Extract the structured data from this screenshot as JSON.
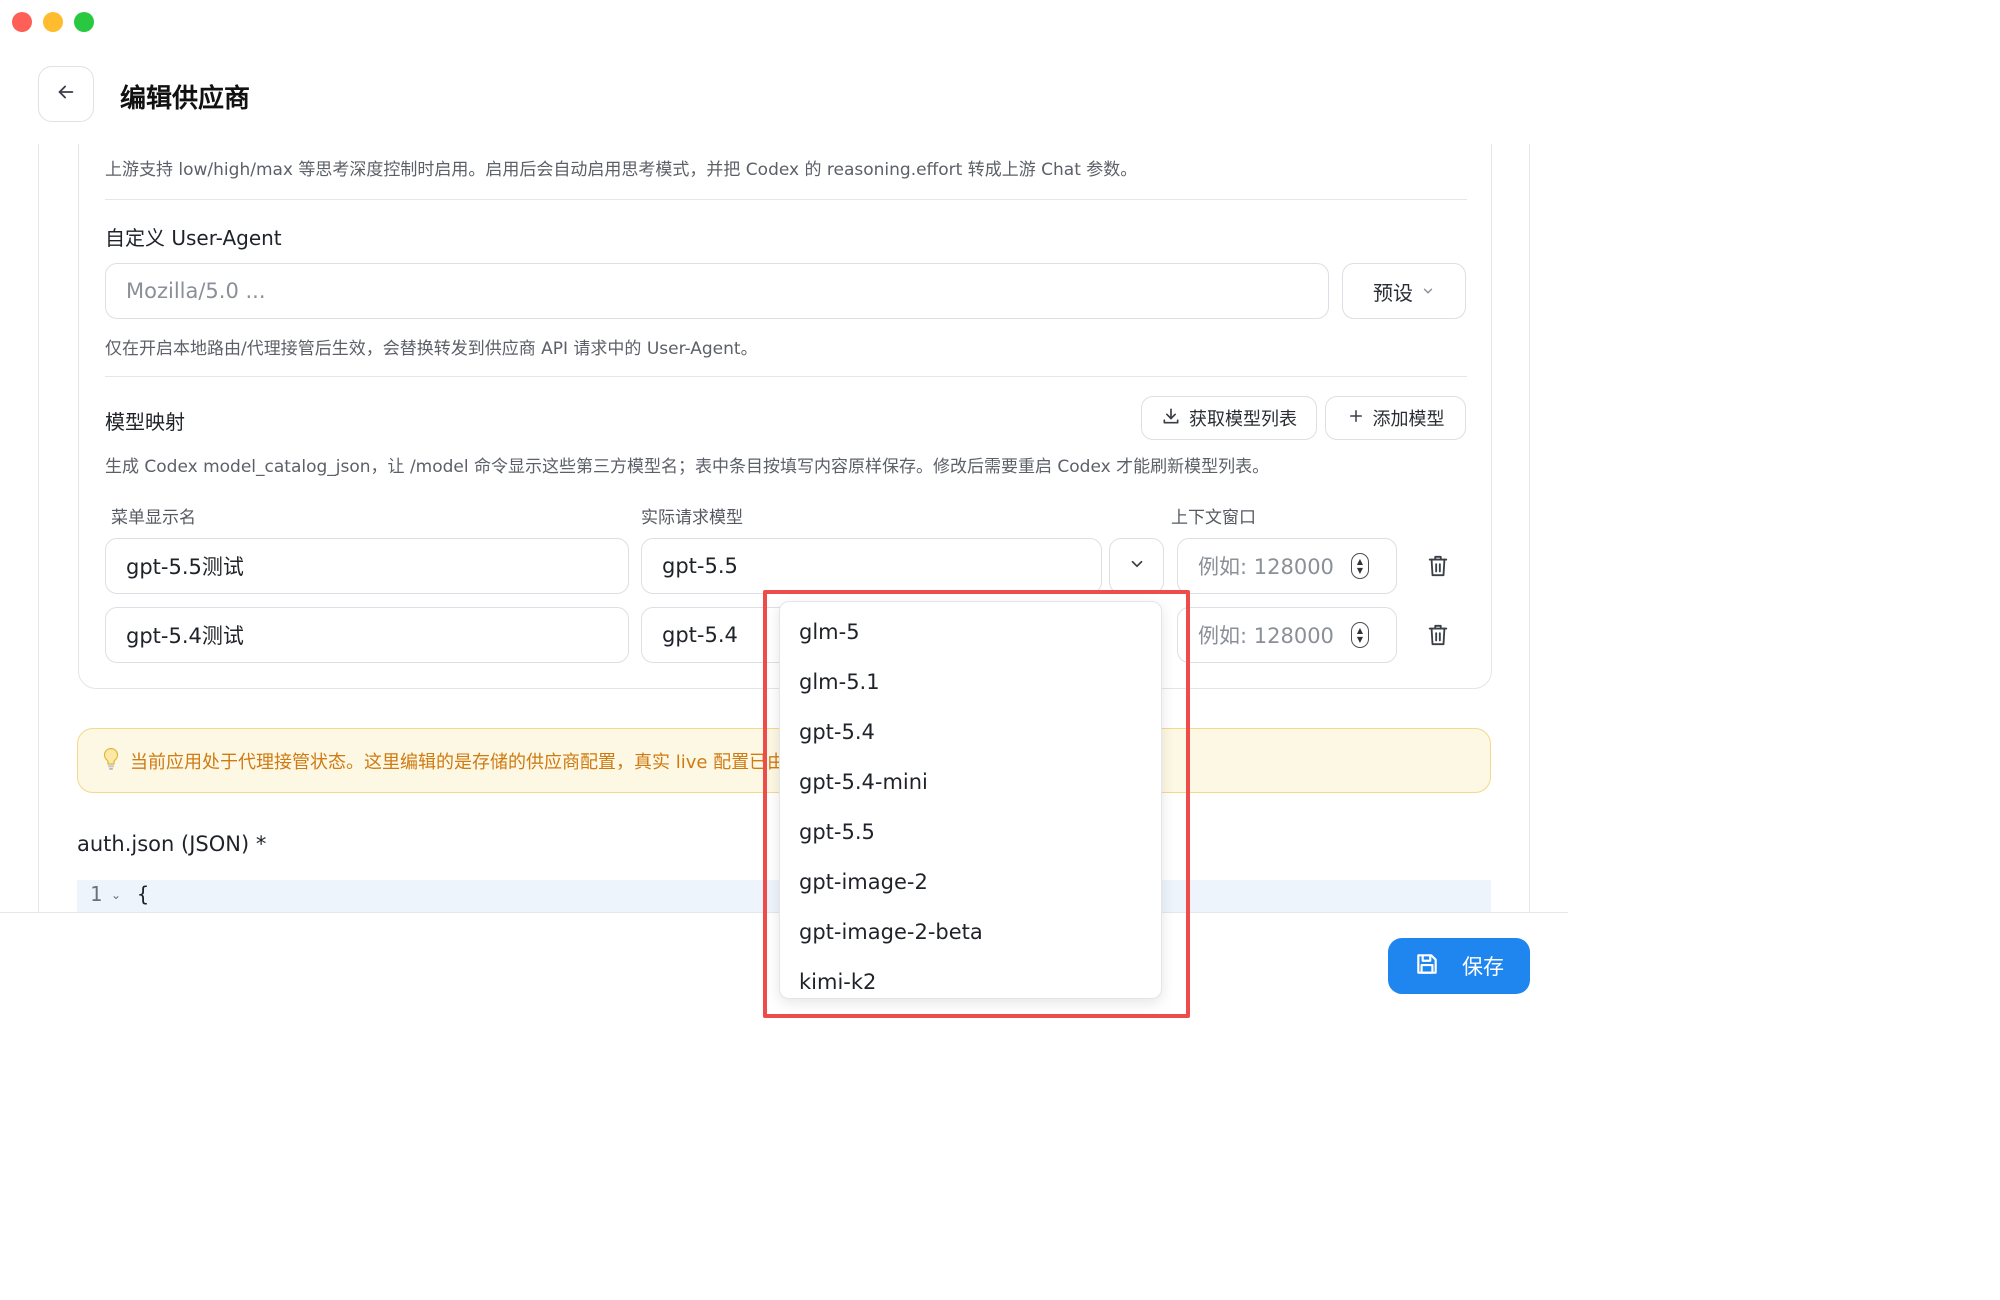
{
  "header": {
    "title": "编辑供应商"
  },
  "reasoning": {
    "hint": "上游支持 low/high/max 等思考深度控制时启用。启用后会自动启用思考模式，并把 Codex 的 reasoning.effort 转成上游 Chat 参数。",
    "enabled": true
  },
  "user_agent": {
    "label": "自定义 User-Agent",
    "placeholder": "Mozilla/5.0 ...",
    "preset_label": "预设",
    "hint": "仅在开启本地路由/代理接管后生效，会替换转发到供应商 API 请求中的 User-Agent。"
  },
  "model_mapping": {
    "title": "模型映射",
    "fetch_label": "获取模型列表",
    "add_label": "添加模型",
    "hint": "生成 Codex model_catalog_json，让 /model 命令显示这些第三方模型名；表中条目按填写内容原样保存。修改后需要重启 Codex 才能刷新模型列表。",
    "columns": {
      "display": "菜单显示名",
      "actual": "实际请求模型",
      "context": "上下文窗口"
    },
    "rows": [
      {
        "display": "gpt-5.5测试",
        "actual": "gpt-5.5",
        "context_placeholder": "例如: 128000"
      },
      {
        "display": "gpt-5.4测试",
        "actual": "gpt-5.4",
        "context_placeholder": "例如: 128000"
      }
    ]
  },
  "notice": {
    "text": "当前应用处于代理接管状态。这里编辑的是存储的供应商配置，真实 live 配置已由"
  },
  "auth_json": {
    "label": "auth.json (JSON) *",
    "line": "1",
    "code": "{"
  },
  "footer": {
    "save_label": "保存"
  },
  "dropdown": {
    "options": [
      "glm-5",
      "glm-5.1",
      "gpt-5.4",
      "gpt-5.4-mini",
      "gpt-5.5",
      "gpt-image-2",
      "gpt-image-2-beta",
      "kimi-k2"
    ]
  },
  "colors": {
    "accent": "#1f86f0",
    "toggle_on": "#14b885",
    "highlight": "#ee4b4b",
    "notice_text": "#d07a12"
  }
}
